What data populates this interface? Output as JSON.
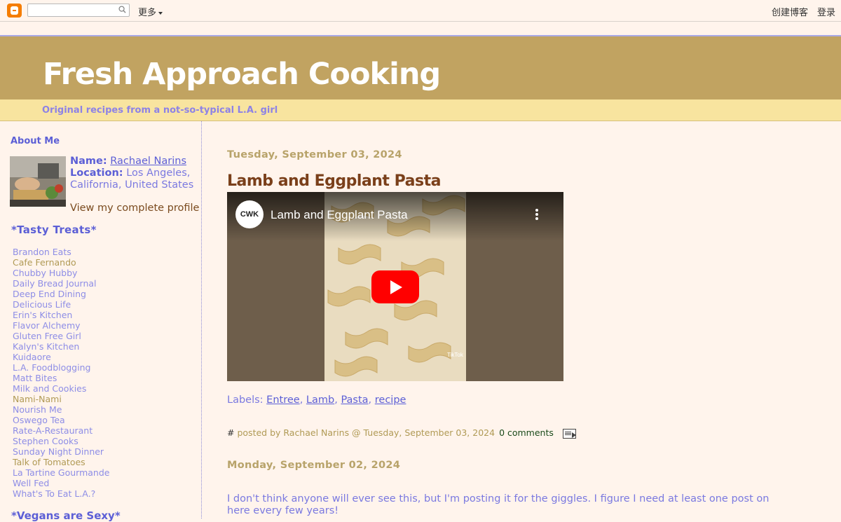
{
  "navbar": {
    "more_label": "更多",
    "create_blog": "创建博客",
    "login": "登录"
  },
  "header": {
    "title": "Fresh Approach Cooking",
    "description": "Original recipes from a not-so-typical L.A. girl"
  },
  "sidebar": {
    "about_heading": "About Me",
    "name_label": "Name:",
    "name_value": "Rachael Narins",
    "location_label": "Location:",
    "location_value": "Los Angeles, California, United States",
    "profile_link": "View my complete profile",
    "treats_heading": "*Tasty Treats*",
    "links": [
      {
        "label": "Brandon Eats",
        "visited": false
      },
      {
        "label": "Cafe Fernando",
        "visited": true
      },
      {
        "label": "Chubby Hubby",
        "visited": false
      },
      {
        "label": "Daily Bread Journal",
        "visited": false
      },
      {
        "label": "Deep End Dining",
        "visited": false
      },
      {
        "label": "Delicious Life",
        "visited": false
      },
      {
        "label": "Erin's Kitchen",
        "visited": false
      },
      {
        "label": "Flavor Alchemy",
        "visited": false
      },
      {
        "label": "Gluten Free Girl",
        "visited": false
      },
      {
        "label": "Kalyn's Kitchen",
        "visited": false
      },
      {
        "label": "Kuidaore",
        "visited": false
      },
      {
        "label": "L.A. Foodblogging",
        "visited": false
      },
      {
        "label": "Matt Bites",
        "visited": false
      },
      {
        "label": "Milk and Cookies",
        "visited": false
      },
      {
        "label": "Nami-Nami",
        "visited": true
      },
      {
        "label": "Nourish Me",
        "visited": false
      },
      {
        "label": "Oswego Tea",
        "visited": false
      },
      {
        "label": "Rate-A-Restaurant",
        "visited": false
      },
      {
        "label": "Stephen Cooks",
        "visited": false
      },
      {
        "label": "Sunday Night Dinner",
        "visited": false
      },
      {
        "label": "Talk of Tomatoes",
        "visited": true
      },
      {
        "label": "La Tartine Gourmande",
        "visited": false
      },
      {
        "label": "Well Fed",
        "visited": false
      },
      {
        "label": "What's To Eat L.A.?",
        "visited": false
      }
    ],
    "vegans_heading": "*Vegans are Sexy*"
  },
  "posts": [
    {
      "date": "Tuesday, September 03, 2024",
      "title": "Lamb and Eggplant Pasta",
      "video": {
        "channel": "CWK",
        "title": "Lamb and Eggplant Pasta",
        "watermark": "TikTok"
      },
      "labels_prefix": "Labels:",
      "labels": [
        "Entree",
        "Lamb",
        "Pasta",
        "recipe"
      ],
      "footer": {
        "hash": "#",
        "posted_by": "posted by Rachael Narins @ Tuesday, September 03, 2024",
        "comments": "0 comments"
      }
    },
    {
      "date": "Monday, September 02, 2024",
      "text": " I don't think anyone will ever see this, but I'm posting it for the giggles. I figure I need at least one post on here every few years!"
    }
  ],
  "colors": {
    "background": "#fff4ec",
    "header": "#c1a361",
    "description_bar": "#f8e49f",
    "link": "#5c5fd6",
    "date": "#b8a36a",
    "post_title": "#7a3f1a"
  }
}
